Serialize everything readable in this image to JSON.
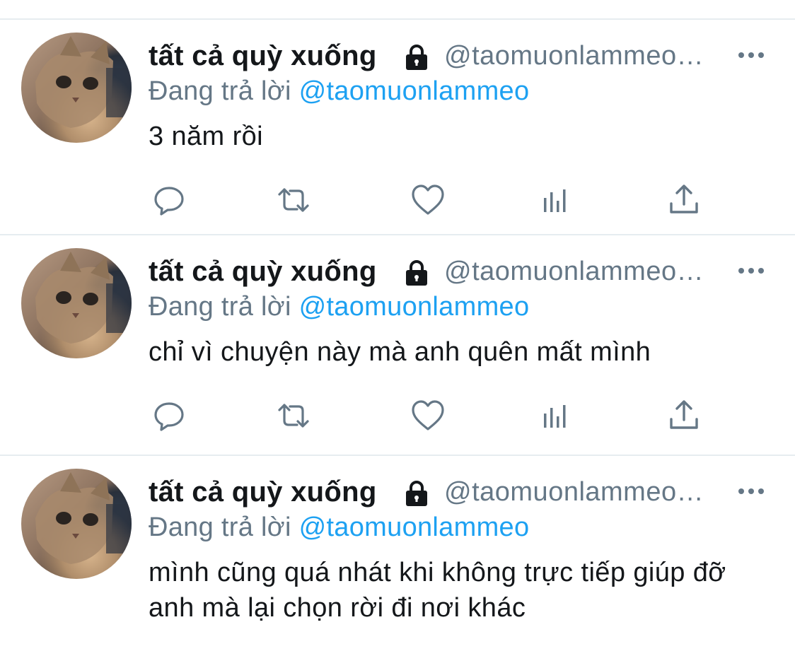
{
  "feed": {
    "tweets": [
      {
        "display_name": "tất cả quỳ xuống",
        "handle": "@taomuonlammeo…",
        "reply_prefix": "Đang trả lời",
        "reply_mention": "@taomuonlammeo",
        "text": "3 năm rồi"
      },
      {
        "display_name": "tất cả quỳ xuống",
        "handle": "@taomuonlammeo…",
        "reply_prefix": "Đang trả lời",
        "reply_mention": "@taomuonlammeo",
        "text": "chỉ vì chuyện này mà anh quên mất mình"
      },
      {
        "display_name": "tất cả quỳ xuống",
        "handle": "@taomuonlammeo…",
        "reply_prefix": "Đang trả lời",
        "reply_mention": "@taomuonlammeo",
        "text": "mình cũng quá nhát khi không trực tiếp giúp đỡ anh mà lại chọn rời đi nơi khác"
      }
    ]
  },
  "icons": {
    "lock": "lock-icon",
    "more": "more-icon",
    "reply": "reply-icon",
    "retweet": "retweet-icon",
    "like": "heart-icon",
    "stats": "stats-icon",
    "share": "share-icon"
  },
  "colors": {
    "text": "#14171a",
    "secondary": "#657786",
    "accent": "#1da1f2",
    "divider": "#e6ecf0"
  }
}
